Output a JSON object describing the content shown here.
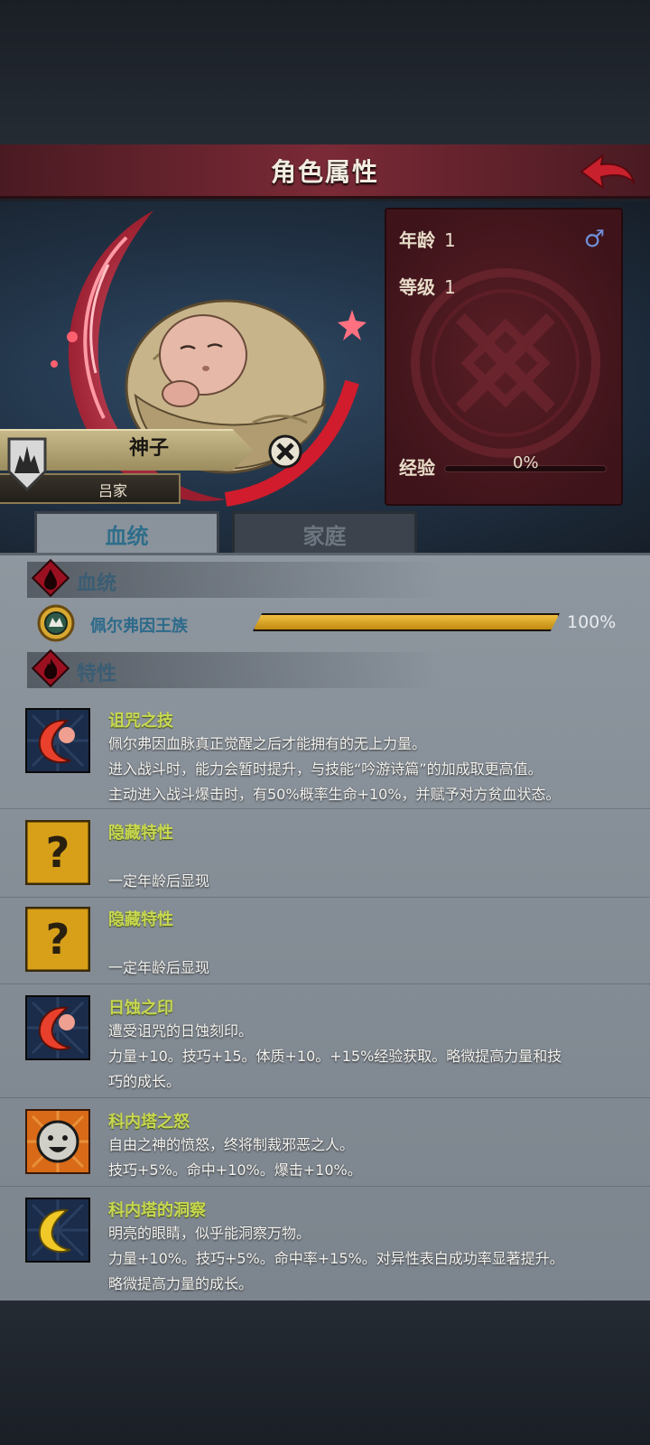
{
  "header": {
    "title": "角色属性"
  },
  "character": {
    "name": "神子",
    "family": "吕家"
  },
  "stats": {
    "age_label": "年龄",
    "age_value": "1",
    "level_label": "等级",
    "level_value": "1",
    "exp_label": "经验",
    "exp_value": "0%",
    "exp_fraction": 0
  },
  "tabs": [
    {
      "label": "血统",
      "active": true
    },
    {
      "label": "家庭",
      "active": false
    }
  ],
  "bloodline_section": {
    "title": "血统",
    "lineage": {
      "name": "佩尔弗因王族",
      "percent_text": "100%",
      "fraction": 1.0
    }
  },
  "traits_section": {
    "title": "特性",
    "items": [
      {
        "name": "诅咒之技",
        "icon": "red-crescent-icon",
        "lines": [
          "佩尔弗因血脉真正觉醒之后才能拥有的无上力量。",
          "进入战斗时，能力会暂时提升，与技能“吟游诗篇”的加成取更高值。",
          "主动进入战斗爆击时，有50%概率生命+10%，并赋予对方贫血状态。"
        ]
      },
      {
        "name": "隐藏特性",
        "icon": "question-mark-icon",
        "lines": [
          "",
          "一定年龄后显现"
        ]
      },
      {
        "name": "隐藏特性",
        "icon": "question-mark-icon",
        "lines": [
          "",
          "一定年龄后显现"
        ]
      },
      {
        "name": "日蚀之印",
        "icon": "red-crescent-icon",
        "lines": [
          "遭受诅咒的日蚀刻印。",
          "力量+10。技巧+15。体质+10。+15%经验获取。略微提高力量和技",
          "巧的成长。"
        ]
      },
      {
        "name": "科内塔之怒",
        "icon": "smiling-face-icon",
        "lines": [
          "自由之神的愤怒，终将制裁邪恶之人。",
          "技巧+5%。命中+10%。爆击+10%。"
        ]
      },
      {
        "name": "科内塔的洞察",
        "icon": "gold-crescent-icon",
        "lines": [
          "明亮的眼睛，似乎能洞察万物。",
          "力量+10%。技巧+5%。命中率+15%。对异性表白成功率显著提升。",
          "略微提高力量的成长。"
        ]
      }
    ]
  },
  "colors": {
    "header_bar": "#7a2a36",
    "stats_card": "#4e1a20",
    "panel": "#8a929b",
    "trait_name": "#c8d850",
    "bloodline_accent": "#2d6a8a",
    "exp_bar_fill": "#c08a10"
  }
}
